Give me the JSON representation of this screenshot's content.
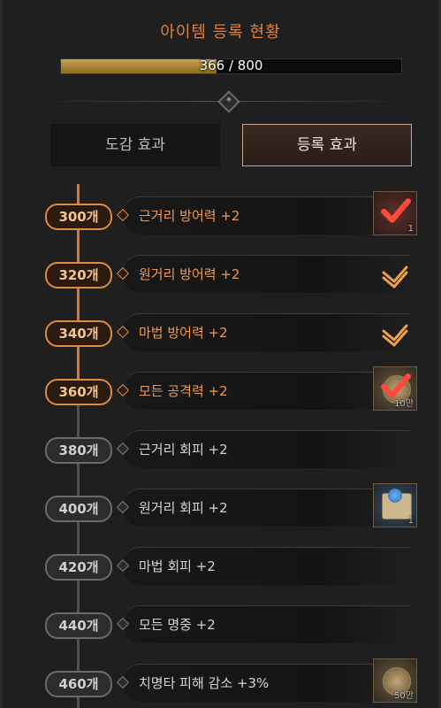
{
  "title": "아이템 등록 현황",
  "progress": {
    "current": 366,
    "max": 800,
    "text": "366 / 800"
  },
  "tabs": [
    {
      "label": "도감 효과",
      "active": false
    },
    {
      "label": "등록 효과",
      "active": true
    }
  ],
  "colors": {
    "accent": "#e08a3c",
    "inactive": "#6a6a6a",
    "check": "#f0a04a"
  },
  "milestones": [
    {
      "count": "300개",
      "effect": "근거리 방어력 +2",
      "achieved": true,
      "reward": {
        "type": "box",
        "icon": "red-check-icon",
        "qty": "1"
      }
    },
    {
      "count": "320개",
      "effect": "원거리 방어력 +2",
      "achieved": true,
      "reward": {
        "type": "check",
        "icon": "double-check-icon"
      }
    },
    {
      "count": "340개",
      "effect": "마법 방어력 +2",
      "achieved": true,
      "reward": {
        "type": "check",
        "icon": "double-check-icon"
      }
    },
    {
      "count": "360개",
      "effect": "모든 공격력 +2",
      "achieved": true,
      "reward": {
        "type": "box",
        "icon": "coin-check-icon",
        "qty": "10만"
      }
    },
    {
      "count": "380개",
      "effect": "근거리 회피 +2",
      "achieved": false,
      "reward": {
        "type": "none"
      }
    },
    {
      "count": "400개",
      "effect": "원거리 회피 +2",
      "achieved": false,
      "reward": {
        "type": "box",
        "icon": "scroll-icon",
        "qty": "1"
      }
    },
    {
      "count": "420개",
      "effect": "마법 회피 +2",
      "achieved": false,
      "reward": {
        "type": "none"
      }
    },
    {
      "count": "440개",
      "effect": "모든 명중 +2",
      "achieved": false,
      "reward": {
        "type": "none"
      }
    },
    {
      "count": "460개",
      "effect": "치명타 피해 감소 +3%",
      "achieved": false,
      "reward": {
        "type": "box",
        "icon": "coin-icon",
        "qty": "50만"
      }
    }
  ]
}
